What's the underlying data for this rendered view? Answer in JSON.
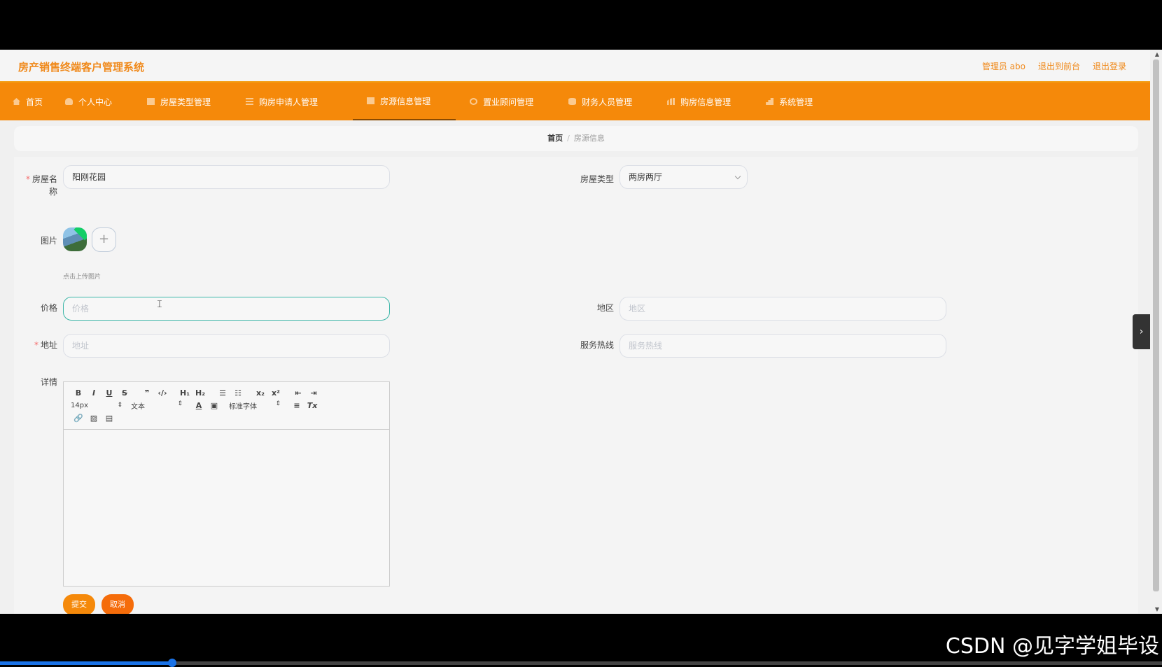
{
  "header": {
    "title": "房产销售终端客户管理系统",
    "admin": "管理员 abo",
    "to_front": "退出到前台",
    "logout": "退出登录"
  },
  "nav": {
    "items": [
      {
        "label": "首页",
        "icon": "home-icon"
      },
      {
        "label": "个人中心",
        "icon": "user-icon"
      },
      {
        "label": "房屋类型管理",
        "icon": "box-icon"
      },
      {
        "label": "购房申请人管理",
        "icon": "list-icon"
      },
      {
        "label": "房源信息管理",
        "icon": "box-icon",
        "active": true
      },
      {
        "label": "置业顾问管理",
        "icon": "ring-icon"
      },
      {
        "label": "财务人员管理",
        "icon": "database-icon"
      },
      {
        "label": "购房信息管理",
        "icon": "bar-chart-icon"
      },
      {
        "label": "系统管理",
        "icon": "chart-icon"
      }
    ]
  },
  "breadcrumb": {
    "home": "首页",
    "separator": "/",
    "current": "房源信息"
  },
  "form": {
    "name_label": "房屋名称",
    "name_value": "阳刚花园",
    "type_label": "房屋类型",
    "type_value": "两房两厅",
    "image_label": "图片",
    "upload_plus": "+",
    "upload_hint": "点击上传图片",
    "price_label": "价格",
    "price_placeholder": "价格",
    "region_label": "地区",
    "region_placeholder": "地区",
    "address_label": "地址",
    "address_placeholder": "地址",
    "hotline_label": "服务热线",
    "hotline_placeholder": "服务热线",
    "detail_label": "详情",
    "submit": "提交",
    "cancel": "取消"
  },
  "editor": {
    "font_size": "14px",
    "text_style": "文本",
    "font_family": "标准字体"
  },
  "watermark": "CSDN @见字学姐毕设",
  "video_progress": 0.148
}
